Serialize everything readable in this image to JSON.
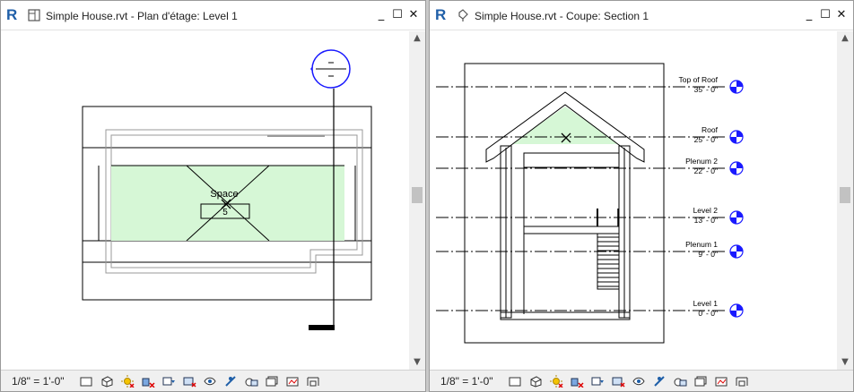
{
  "left_window": {
    "app_logo": "R",
    "title": "Simple House.rvt - Plan d'étage: Level 1",
    "view_icon": "floor-plan-icon",
    "controls": {
      "minimize": "_",
      "restore": "☐",
      "close": "✕"
    },
    "drawing": {
      "space_label": "Space",
      "space_number": "5"
    },
    "status": {
      "scale": "1/8\" = 1'-0\""
    }
  },
  "right_window": {
    "app_logo": "R",
    "title": "Simple House.rvt - Coupe: Section 1",
    "view_icon": "section-icon",
    "controls": {
      "minimize": "_",
      "restore": "☐",
      "close": "✕"
    },
    "levels": [
      {
        "name": "Top of Roof",
        "elevation": "35' - 0\""
      },
      {
        "name": "Roof",
        "elevation": "25' - 0\""
      },
      {
        "name": "Plenum 2",
        "elevation": "22' - 0\""
      },
      {
        "name": "Level 2",
        "elevation": "13' - 0\""
      },
      {
        "name": "Plenum 1",
        "elevation": "9' - 0\""
      },
      {
        "name": "Level 1",
        "elevation": "0' - 0\""
      }
    ],
    "status": {
      "scale": "1/8\" = 1'-0\""
    }
  },
  "scroll": {
    "up": "▲",
    "down": "▼"
  },
  "view_control_icons": [
    "detail-level-icon",
    "visual-style-icon",
    "sun-path-icon",
    "shadows-icon",
    "crop-view-icon",
    "show-crop-region-icon",
    "temporary-hide-icon",
    "reveal-hidden-icon",
    "temporary-view-properties-icon",
    "hide-analytical-icon",
    "highlight-displacement-icon",
    "reveal-constraints-icon"
  ],
  "colors": {
    "space_fill": "#d6f7d6",
    "revit_blue": "#1f5fa8",
    "symbol_blue": "#1a1aff"
  }
}
